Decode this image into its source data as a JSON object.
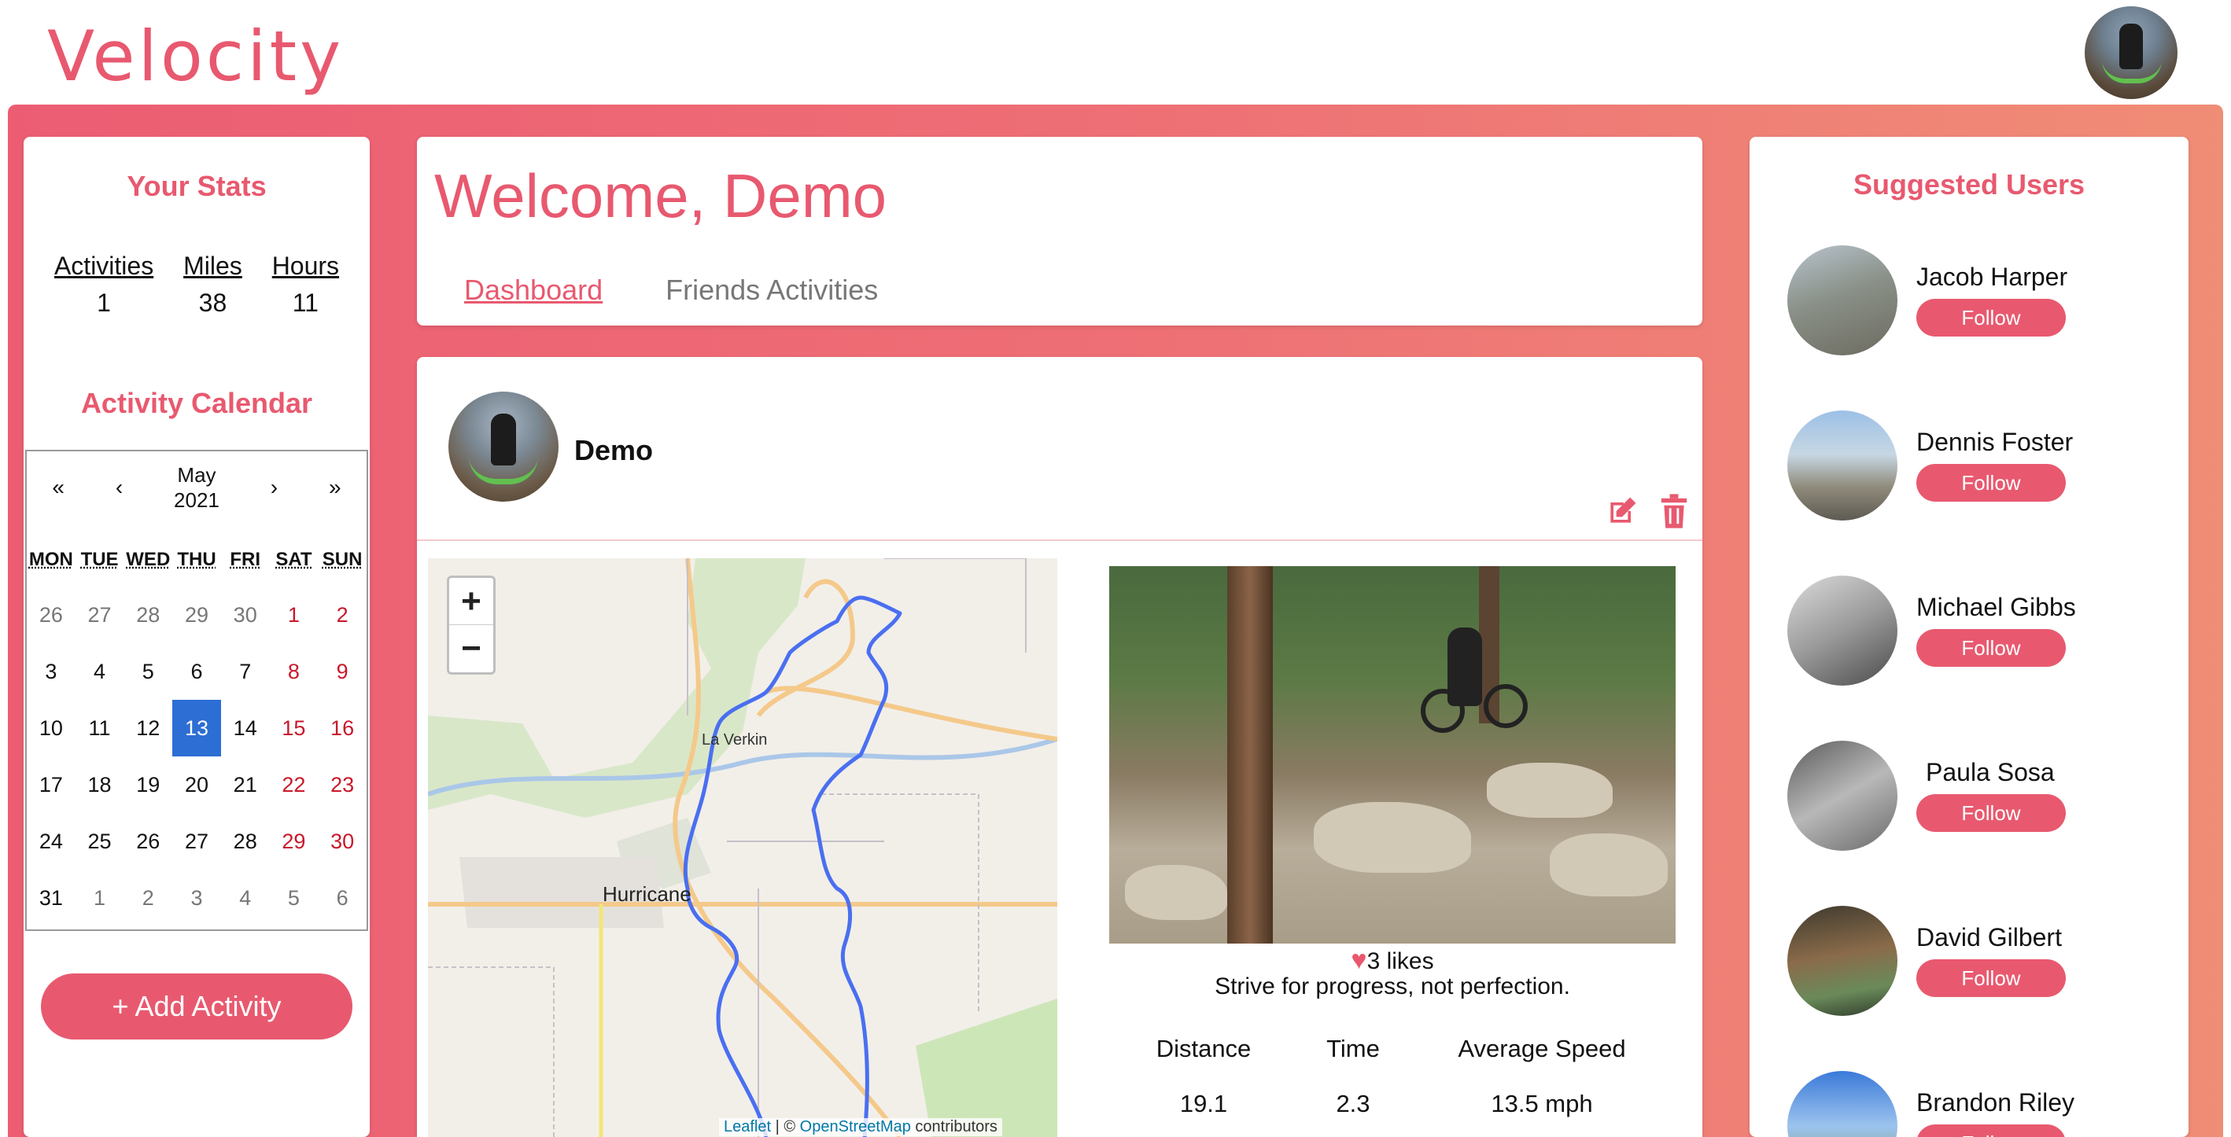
{
  "app": {
    "logo": "Velocity"
  },
  "stats": {
    "title": "Your Stats",
    "items": [
      {
        "label": "Activities",
        "value": "1"
      },
      {
        "label": "Miles",
        "value": "38"
      },
      {
        "label": "Hours",
        "value": "11"
      }
    ]
  },
  "calendar": {
    "title": "Activity Calendar",
    "nav": {
      "prev_year": "«",
      "prev_month": "‹",
      "month": "May",
      "year": "2021",
      "next_month": "›",
      "next_year": "»"
    },
    "weekdays": [
      "MON",
      "TUE",
      "WED",
      "THU",
      "FRI",
      "SAT",
      "SUN"
    ],
    "days": [
      [
        "26",
        "27",
        "28",
        "29",
        "30",
        "1",
        "2"
      ],
      [
        "3",
        "4",
        "5",
        "6",
        "7",
        "8",
        "9"
      ],
      [
        "10",
        "11",
        "12",
        "13",
        "14",
        "15",
        "16"
      ],
      [
        "17",
        "18",
        "19",
        "20",
        "21",
        "22",
        "23"
      ],
      [
        "24",
        "25",
        "26",
        "27",
        "28",
        "29",
        "30"
      ],
      [
        "31",
        "1",
        "2",
        "3",
        "4",
        "5",
        "6"
      ]
    ],
    "selected": "13"
  },
  "add_activity_label": "+ Add Activity",
  "welcome": {
    "title": "Welcome, Demo",
    "tabs": [
      "Dashboard",
      "Friends Activities"
    ]
  },
  "activity": {
    "user": "Demo",
    "likes": "3 likes",
    "caption": "Strive for progress, not perfection.",
    "metric_headers": [
      "Distance",
      "Time",
      "Average Speed"
    ],
    "metric_values": [
      "19.1",
      "2.3",
      "13.5 mph"
    ],
    "map": {
      "zoom_in": "+",
      "zoom_out": "−",
      "labels": [
        "La Verkin",
        "Hurricane"
      ],
      "attribution_leaflet": "Leaflet",
      "attribution_sep": " | © ",
      "attribution_osm": "OpenStreetMap",
      "attribution_tail": " contributors"
    }
  },
  "suggested": {
    "title": "Suggested Users",
    "follow_label": "Follow",
    "users": [
      "Jacob Harper",
      "Dennis Foster",
      "Michael Gibbs",
      "Paula Sosa",
      "David Gilbert",
      "Brandon Riley"
    ]
  },
  "colors": {
    "accent": "#e8596f",
    "today": "#2d6ed4",
    "route": "#4a6ff0"
  }
}
